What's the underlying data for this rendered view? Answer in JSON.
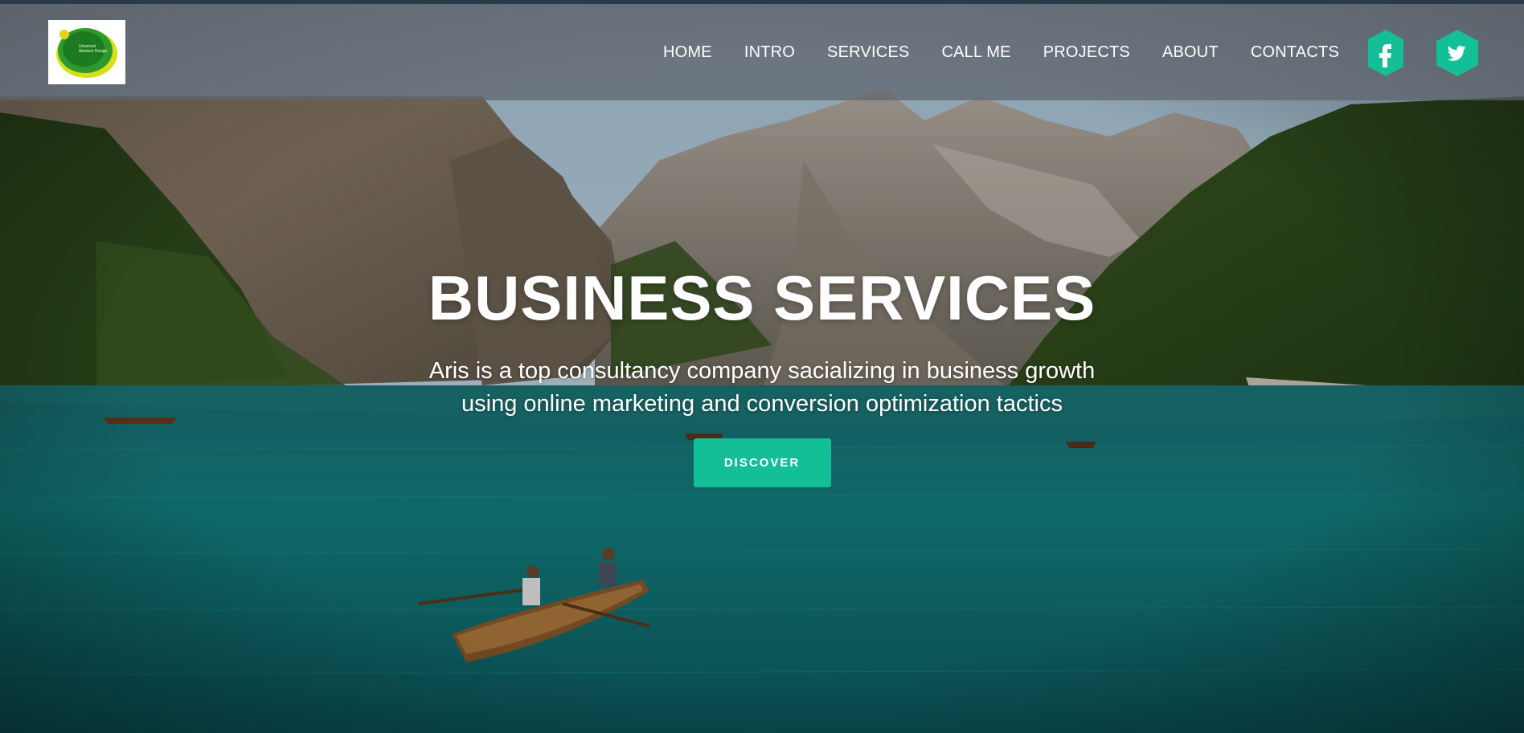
{
  "header": {
    "logo_alt": "Universal Abstract Design",
    "nav_items": [
      {
        "label": "HOME"
      },
      {
        "label": "INTRO"
      },
      {
        "label": "SERVICES"
      },
      {
        "label": "CALL ME"
      },
      {
        "label": "PROJECTS"
      },
      {
        "label": "ABOUT"
      },
      {
        "label": "CONTACTS"
      }
    ],
    "social": [
      {
        "icon": "facebook-icon",
        "glyph": "f"
      },
      {
        "icon": "twitter-icon",
        "glyph": "twitter-bird"
      }
    ]
  },
  "hero": {
    "title": "BUSINESS SERVICES",
    "subtitle_line1": "Aris is a top consultancy company sacializing in business growth",
    "subtitle_line2": "using online marketing and conversion optimization tactics",
    "cta_label": "DISCOVER"
  },
  "colors": {
    "accent": "#14be97",
    "navbar": "#5f646c",
    "text": "#ffffff"
  }
}
